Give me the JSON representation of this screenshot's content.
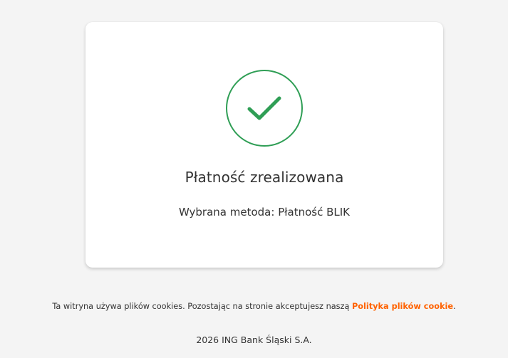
{
  "card": {
    "title": "Płatność zrealizowana",
    "method_label": "Wybrana metoda:",
    "method_value": "Płatność BLIK",
    "icon": "check-circle-icon"
  },
  "cookie_notice": {
    "text": "Ta witryna używa plików cookies. Pozostając na stronie akceptujesz naszą",
    "link_label": "Polityka plików cookie",
    "suffix": "."
  },
  "footer": {
    "copyright": "2026 ING Bank Śląski S.A."
  },
  "colors": {
    "success_green": "#2f9e55",
    "link_orange": "#ff6200",
    "background": "#f4f4f4"
  }
}
